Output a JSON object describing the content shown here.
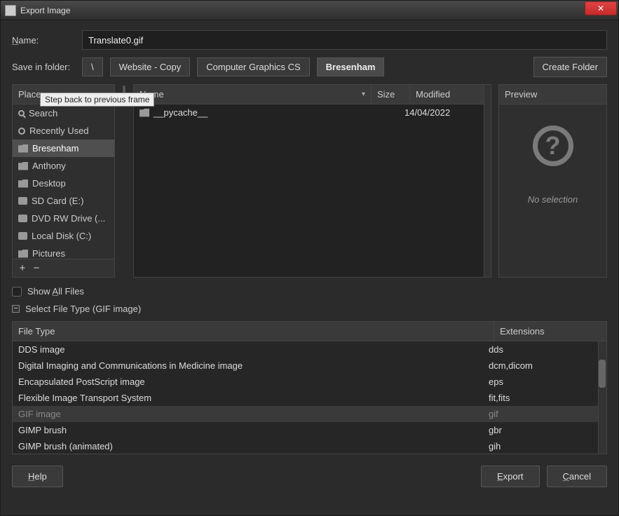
{
  "window": {
    "title": "Export Image"
  },
  "name": {
    "label": "Name:",
    "value": "Translate0.gif"
  },
  "save_in": {
    "label": "Save in folder:",
    "crumbs": [
      "\\",
      "Website - Copy",
      "Computer Graphics CS",
      "Bresenham"
    ],
    "active_index": 3,
    "create_folder": "Create Folder"
  },
  "tooltip": "Step back to previous frame",
  "places": {
    "header": "Places",
    "items": [
      {
        "icon": "search",
        "label": "Search"
      },
      {
        "icon": "clock",
        "label": "Recently Used"
      },
      {
        "icon": "folder",
        "label": "Bresenham",
        "selected": true
      },
      {
        "icon": "folder",
        "label": "Anthony"
      },
      {
        "icon": "folder",
        "label": "Desktop"
      },
      {
        "icon": "disk",
        "label": "SD Card (E:)"
      },
      {
        "icon": "disk",
        "label": "DVD RW Drive (..."
      },
      {
        "icon": "disk",
        "label": "Local Disk (C:)"
      },
      {
        "icon": "folder",
        "label": "Pictures"
      }
    ],
    "add": "+",
    "remove": "−"
  },
  "files": {
    "columns": {
      "name": "Name",
      "size": "Size",
      "modified": "Modified"
    },
    "rows": [
      {
        "name": "__pycache__",
        "size": "",
        "modified": "14/04/2022"
      }
    ]
  },
  "preview": {
    "header": "Preview",
    "no_selection": "No selection"
  },
  "show_all": {
    "label": "Show All Files"
  },
  "select_ft": {
    "label": "Select File Type (GIF image)"
  },
  "filetype": {
    "columns": {
      "name": "File Type",
      "ext": "Extensions"
    },
    "rows": [
      {
        "name": "DDS image",
        "ext": "dds"
      },
      {
        "name": "Digital Imaging and Communications in Medicine image",
        "ext": "dcm,dicom"
      },
      {
        "name": "Encapsulated PostScript image",
        "ext": "eps"
      },
      {
        "name": "Flexible Image Transport System",
        "ext": "fit,fits"
      },
      {
        "name": "GIF image",
        "ext": "gif",
        "selected": true
      },
      {
        "name": "GIMP brush",
        "ext": "gbr"
      },
      {
        "name": "GIMP brush (animated)",
        "ext": "gih"
      }
    ]
  },
  "buttons": {
    "help": "Help",
    "export": "Export",
    "cancel": "Cancel"
  }
}
